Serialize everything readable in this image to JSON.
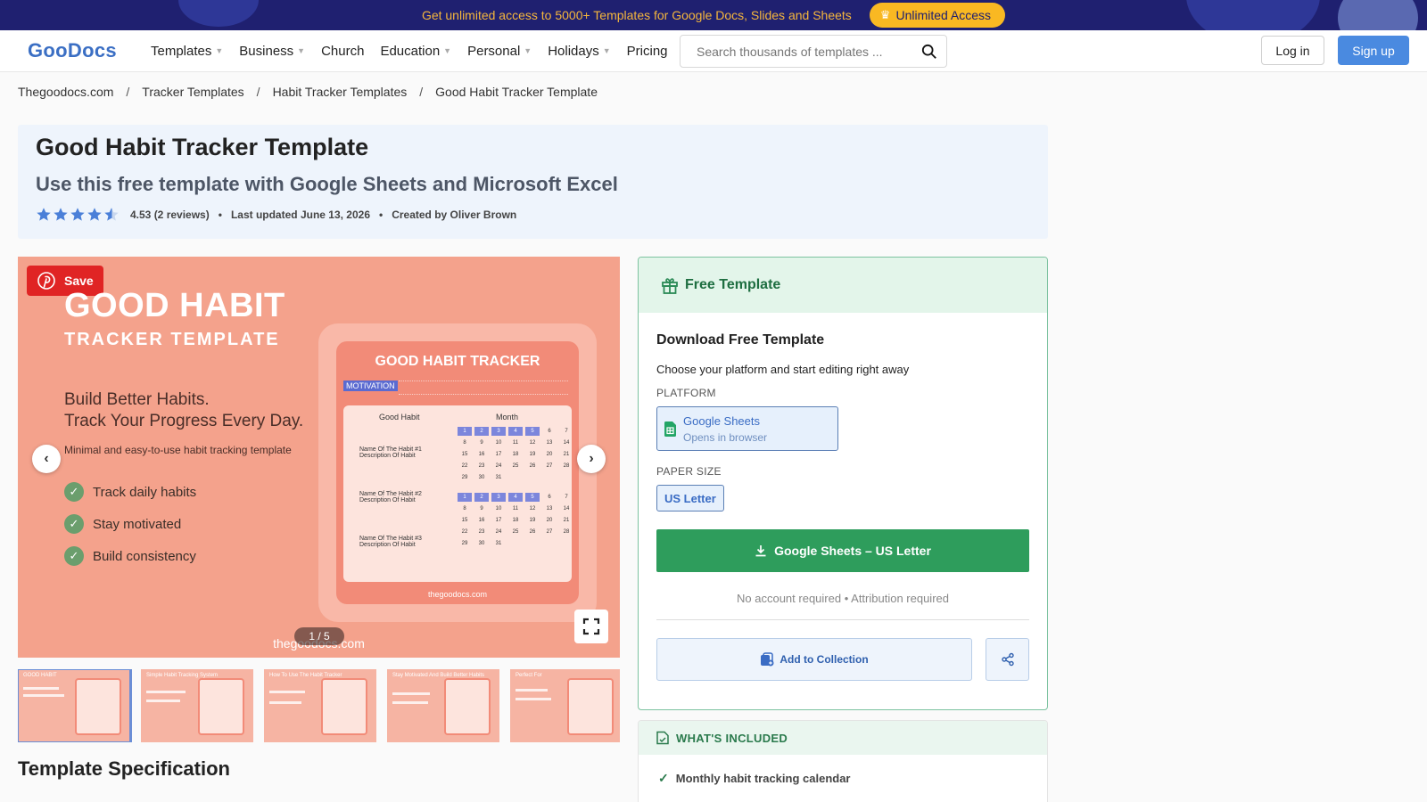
{
  "promo": {
    "text": "Get unlimited access to 5000+ Templates for Google Docs, Slides and Sheets",
    "button_label": "Unlimited Access"
  },
  "header": {
    "logo": "GooDocs",
    "nav": [
      {
        "label": "Templates",
        "dropdown": true
      },
      {
        "label": "Business",
        "dropdown": true
      },
      {
        "label": "Church",
        "dropdown": false
      },
      {
        "label": "Education",
        "dropdown": true
      },
      {
        "label": "Personal",
        "dropdown": true
      },
      {
        "label": "Holidays",
        "dropdown": true
      },
      {
        "label": "Pricing",
        "dropdown": false
      }
    ],
    "search_placeholder": "Search thousands of templates ...",
    "login_label": "Log in",
    "signup_label": "Sign up"
  },
  "breadcrumb": [
    "Thegoodocs.com",
    "Tracker Templates",
    "Habit Tracker Templates",
    "Good Habit Tracker Template"
  ],
  "breadcrumb_sep": "/",
  "page": {
    "title": "Good Habit Tracker Template",
    "subtitle": "Use this free template with Google Sheets and Microsoft Excel",
    "rating_value": 4.53,
    "rating_text": "4.53 (2 reviews)",
    "updated": "Last updated June 13, 2026",
    "author": "Created by Oliver Brown",
    "bullet": "•"
  },
  "gallery": {
    "save_label": "Save",
    "preview_title": "GOOD HABIT",
    "preview_subtitle": "TRACKER TEMPLATE",
    "tagline1": "Build Better Habits.",
    "tagline2": "Track Your Progress Every Day.",
    "description": "Minimal and easy-to-use habit tracking template",
    "features": [
      "Track daily habits",
      "Stay motivated",
      "Build consistency"
    ],
    "tablet": {
      "title": "GOOD HABIT TRACKER",
      "motivation": "MOTIVATION",
      "col_habit": "Good Habit",
      "col_month": "Month",
      "habits": [
        {
          "name": "Name Of The Habit #1",
          "desc": "Description Of Habit"
        },
        {
          "name": "Name Of The Habit #2",
          "desc": "Description Of Habit"
        },
        {
          "name": "Name Of The Habit #3",
          "desc": "Description Of Habit"
        }
      ],
      "footer": "thegoodocs.com"
    },
    "footer": "thegoodocs.com",
    "counter": "1 / 5",
    "prev_arrow": "‹",
    "next_arrow": "›",
    "thumbnails": [
      {
        "caption": "GOOD HABIT",
        "active": true
      },
      {
        "caption": "Simple Habit Tracking System",
        "active": false
      },
      {
        "caption": "How To Use The Habit Tracker",
        "active": false
      },
      {
        "caption": "Stay Motivated And Build Better Habits",
        "active": false
      },
      {
        "caption": "Perfect For",
        "active": false
      }
    ]
  },
  "download": {
    "badge": "Free Template",
    "title": "Download Free Template",
    "description": "Choose your platform and start editing right away",
    "platform_label": "PLATFORM",
    "platform_name": "Google Sheets",
    "platform_sub": "Opens in browser",
    "paper_label": "PAPER SIZE",
    "paper_value": "US Letter",
    "button_label": "Google Sheets – US Letter",
    "note": "No account required • Attribution required",
    "collection_label": "Add to Collection"
  },
  "included": {
    "heading": "WHAT'S INCLUDED",
    "items": [
      "Monthly habit tracking calendar"
    ]
  },
  "spec_title": "Template Specification",
  "colors": {
    "brand": "#4a8ae0",
    "download_green": "#2e9d5c",
    "promo_bg": "#1f2070",
    "promo_accent": "#f9b822",
    "preview_coral": "#f4a28c"
  }
}
